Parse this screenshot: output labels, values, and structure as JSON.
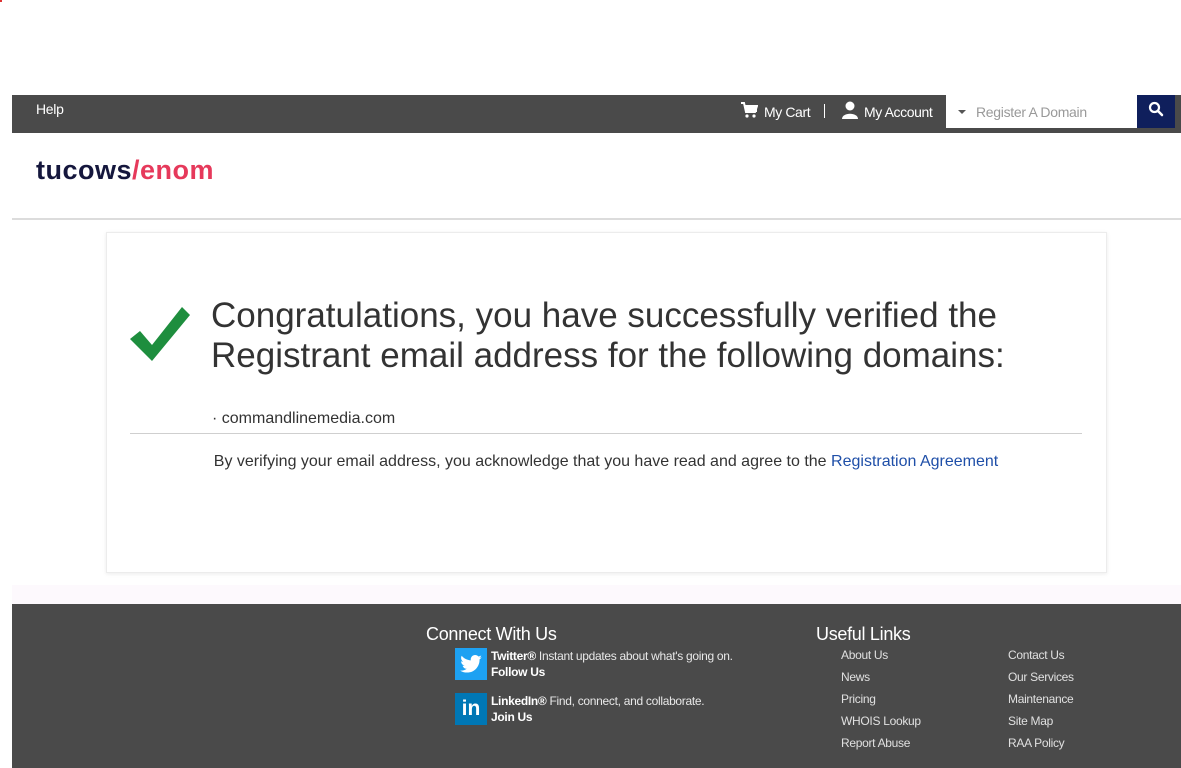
{
  "topbar": {
    "help_label": "Help",
    "cart_label": "My Cart",
    "account_label": "My Account",
    "search_placeholder": "Register A Domain"
  },
  "logo": {
    "part1": "tucows",
    "slash": "/",
    "part2": "enom"
  },
  "main": {
    "headline": "Congratulations, you have successfully verified the Registrant email address for the following domains:",
    "domains": [
      "· commandlinemedia.com"
    ],
    "agreement_text": "By verifying your email address, you acknowledge that you have read and agree to the ",
    "agreement_link": "Registration Agreement"
  },
  "footer": {
    "connect_heading": "Connect With Us",
    "twitter": {
      "name": "Twitter®",
      "desc": " Instant updates about what's going on.",
      "action": "Follow Us"
    },
    "linkedin": {
      "name": "LinkedIn®",
      "desc": " Find, connect, and collaborate.",
      "action": "Join Us"
    },
    "links_heading": "Useful Links",
    "links_col1": [
      "About Us",
      "News",
      "Pricing",
      "WHOIS Lookup",
      "Report Abuse"
    ],
    "links_col2": [
      "Contact Us",
      "Our Services",
      "Maintenance",
      "Site Map",
      "RAA Policy"
    ]
  },
  "colors": {
    "topbar_bg": "#4a4a4a",
    "search_button_bg": "#0f1f5c",
    "logo_dark": "#15173d",
    "logo_accent": "#e6395b",
    "check_green": "#1e8e3e",
    "link_blue": "#1f4fa8",
    "twitter_blue": "#1da1f2",
    "linkedin_blue": "#0077b5"
  }
}
